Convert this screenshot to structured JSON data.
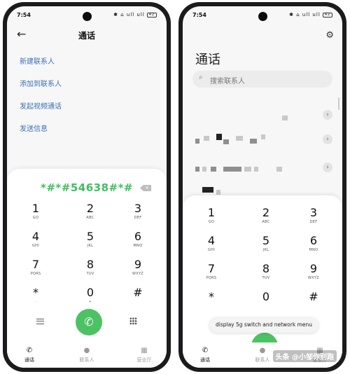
{
  "status": {
    "time": "7:54",
    "icons": "✱ ⌂ ull ull",
    "battery": "42"
  },
  "left": {
    "title": "通话",
    "menu": [
      "新建联系人",
      "添加到联系人",
      "发起视频通话",
      "发送信息"
    ],
    "dial_number": "*#*#54638#*#",
    "keys": [
      {
        "d": "1",
        "l": "GO"
      },
      {
        "d": "2",
        "l": "ABC"
      },
      {
        "d": "3",
        "l": "DEF"
      },
      {
        "d": "4",
        "l": "GHI"
      },
      {
        "d": "5",
        "l": "JKL"
      },
      {
        "d": "6",
        "l": "MNO"
      },
      {
        "d": "7",
        "l": "PQRS"
      },
      {
        "d": "8",
        "l": "TUV"
      },
      {
        "d": "9",
        "l": "WXYZ"
      },
      {
        "d": "*",
        "l": "·"
      },
      {
        "d": "0",
        "l": "+"
      },
      {
        "d": "#",
        "l": ""
      }
    ],
    "tabs": [
      "通话",
      "联系人",
      "营业厅"
    ]
  },
  "right": {
    "title": "通话",
    "search_placeholder": "搜索联系人",
    "keys": [
      {
        "d": "1",
        "l": "GO"
      },
      {
        "d": "2",
        "l": "ABC"
      },
      {
        "d": "3",
        "l": "DEF"
      },
      {
        "d": "4",
        "l": "GHI"
      },
      {
        "d": "5",
        "l": "JKL"
      },
      {
        "d": "6",
        "l": "MNO"
      },
      {
        "d": "7",
        "l": "PQRS"
      },
      {
        "d": "8",
        "l": "TUV"
      },
      {
        "d": "9",
        "l": "WXYZ"
      },
      {
        "d": "*",
        "l": ""
      },
      {
        "d": "0",
        "l": ""
      },
      {
        "d": "#",
        "l": ""
      }
    ],
    "toast": "display 5g switch and network menu",
    "tabs": [
      "通话",
      "联系人",
      "营业厅"
    ],
    "watermark": "头条 @小邹你别跑"
  },
  "colors": {
    "accent_green": "#3fbf5f",
    "link_blue": "#3c70b8",
    "call_green": "#4cc264"
  }
}
